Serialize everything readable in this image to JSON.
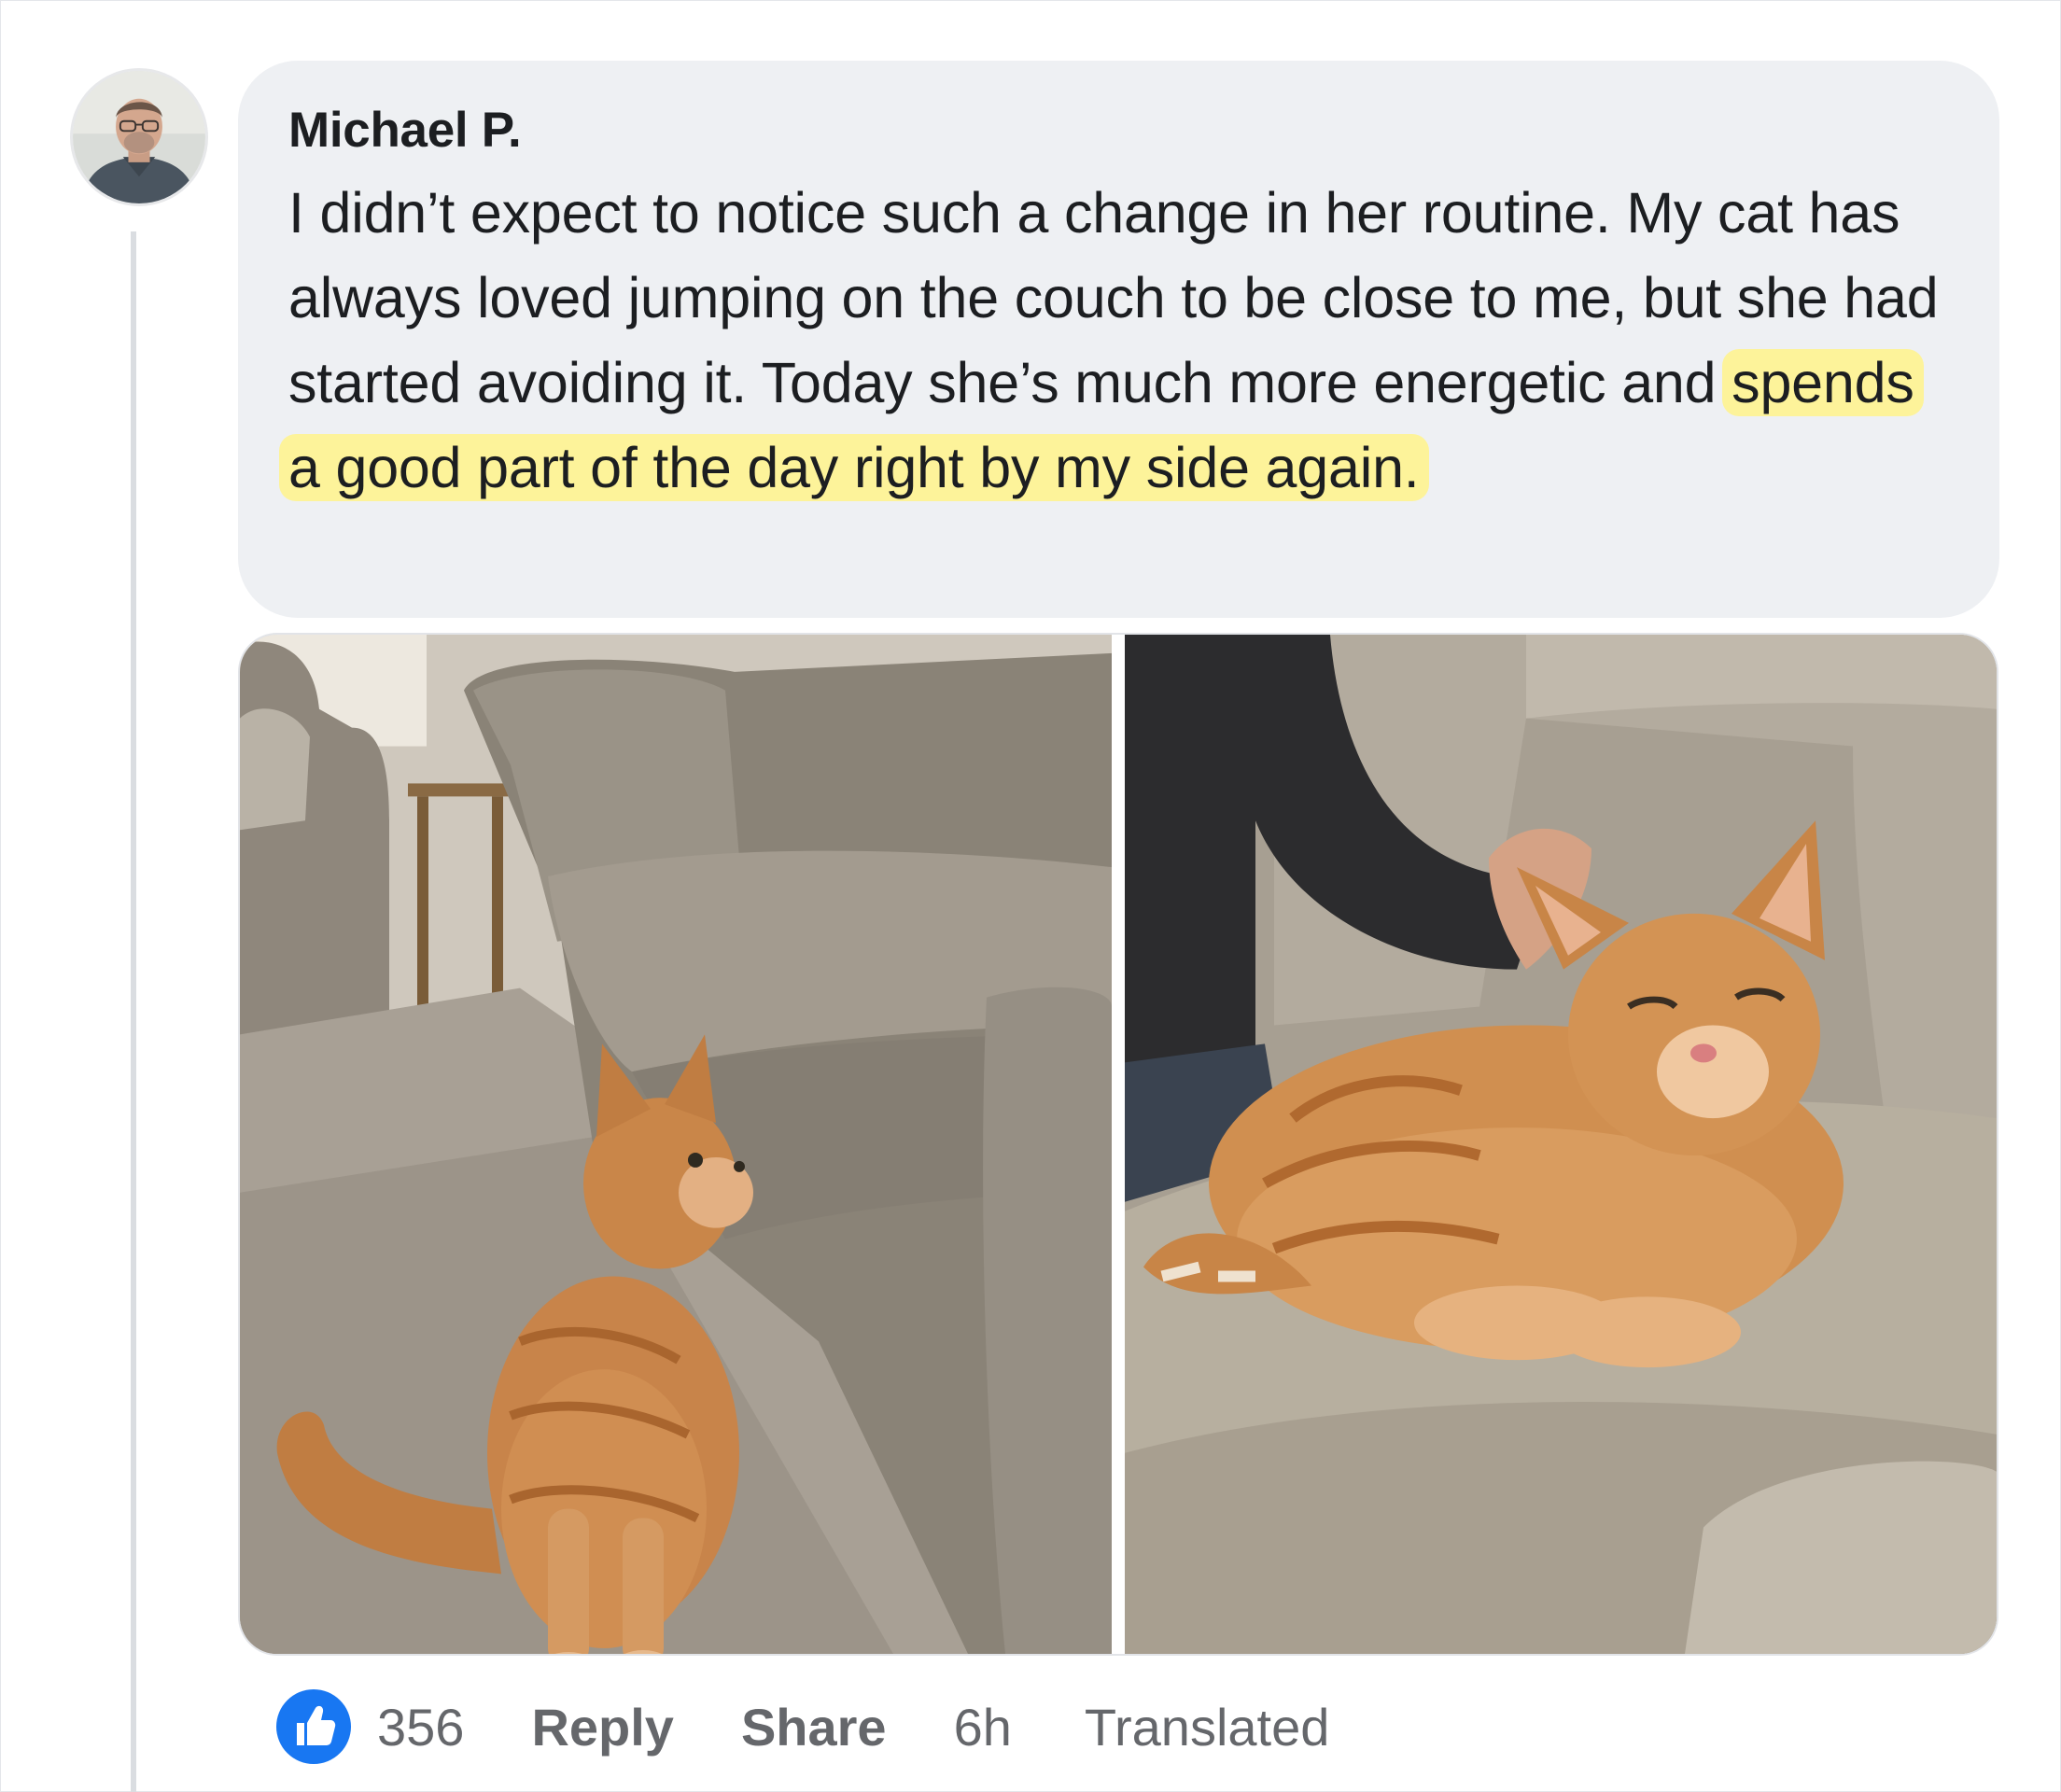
{
  "comment": {
    "author": "Michael P.",
    "text_plain": "I didn’t expect to notice such a change in her routine. My cat has always loved jumping on the couch to be close to me, but she had started avoiding it. Today she’s much more energetic and ",
    "text_highlight": "spends a good part of the day right by my side again.",
    "images": [
      {
        "name": "cat-sitting-by-couch-photo"
      },
      {
        "name": "cat-on-couch-being-petted-photo"
      }
    ]
  },
  "actions": {
    "like_icon": "thumbs-up-icon",
    "like_count": "356",
    "reply_label": "Reply",
    "share_label": "Share",
    "time": "6h",
    "translated_label": "Translated"
  },
  "colors": {
    "bubble": "#eef0f3",
    "highlight": "#fdf39a",
    "like_blue": "#1877f2",
    "meta_gray": "#65676b"
  }
}
